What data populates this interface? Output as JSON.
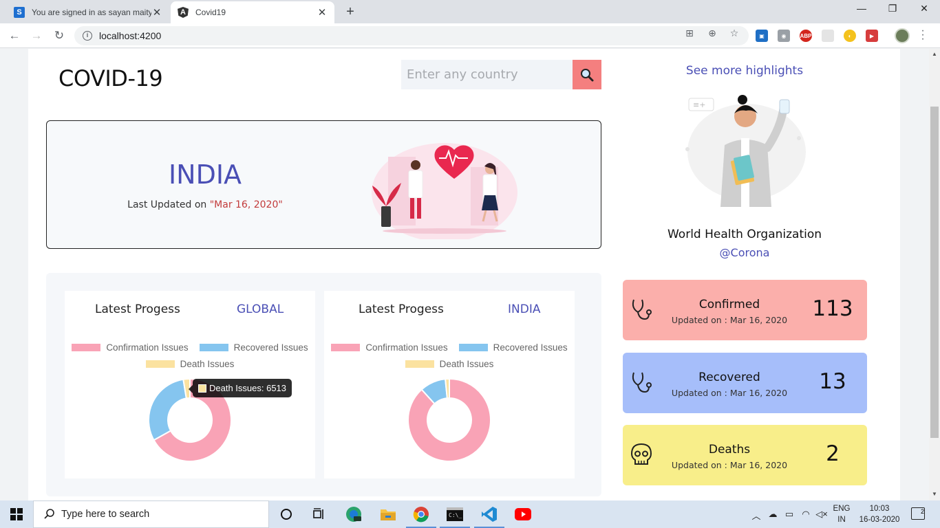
{
  "browser": {
    "tabs": [
      {
        "favicon": "S",
        "title": "You are signed in as sayan maity",
        "active": false
      },
      {
        "favicon": "A",
        "title": "Covid19",
        "active": true
      }
    ],
    "url": "localhost:4200"
  },
  "header": {
    "logo": "COVID-19",
    "search_placeholder": "Enter any country"
  },
  "hero": {
    "country": "INDIA",
    "updated_prefix": "Last Updated on ",
    "updated_date": "\"Mar 16, 2020\""
  },
  "charts": [
    {
      "title": "Latest Progess",
      "scope": "GLOBAL",
      "tooltip": "Death Issues: 6513"
    },
    {
      "title": "Latest Progess",
      "scope": "INDIA"
    }
  ],
  "chart_data": [
    {
      "type": "pie",
      "scope": "GLOBAL",
      "categories": [
        "Confirmation Issues",
        "Recovered Issues",
        "Death Issues"
      ],
      "values": [
        169000,
        77000,
        6513
      ],
      "colors": [
        "#f9a3b6",
        "#85c5ef",
        "#fbe2a0"
      ]
    },
    {
      "type": "pie",
      "scope": "INDIA",
      "categories": [
        "Confirmation Issues",
        "Recovered Issues",
        "Death Issues"
      ],
      "values": [
        113,
        13,
        2
      ],
      "colors": [
        "#f9a3b6",
        "#85c5ef",
        "#fbe2a0"
      ]
    }
  ],
  "sidebar": {
    "see_more": "See more highlights",
    "org_name": "World Health Organization",
    "org_handle": "@Corona"
  },
  "stats": [
    {
      "label": "Confirmed",
      "updated": "Updated on : Mar 16, 2020",
      "value": "113",
      "color": "#fbafab",
      "icon": "stethoscope-icon"
    },
    {
      "label": "Recovered",
      "updated": "Updated on : Mar 16, 2020",
      "value": "13",
      "color": "#a6befa",
      "icon": "stethoscope-icon"
    },
    {
      "label": "Deaths",
      "updated": "Updated on : Mar 16, 2020",
      "value": "2",
      "color": "#f8ee8a",
      "icon": "skull-icon"
    }
  ],
  "taskbar": {
    "search_placeholder": "Type here to search",
    "lang_line1": "ENG",
    "lang_line2": "IN",
    "time": "10:03",
    "date": "16-03-2020",
    "notification_count": "2"
  }
}
